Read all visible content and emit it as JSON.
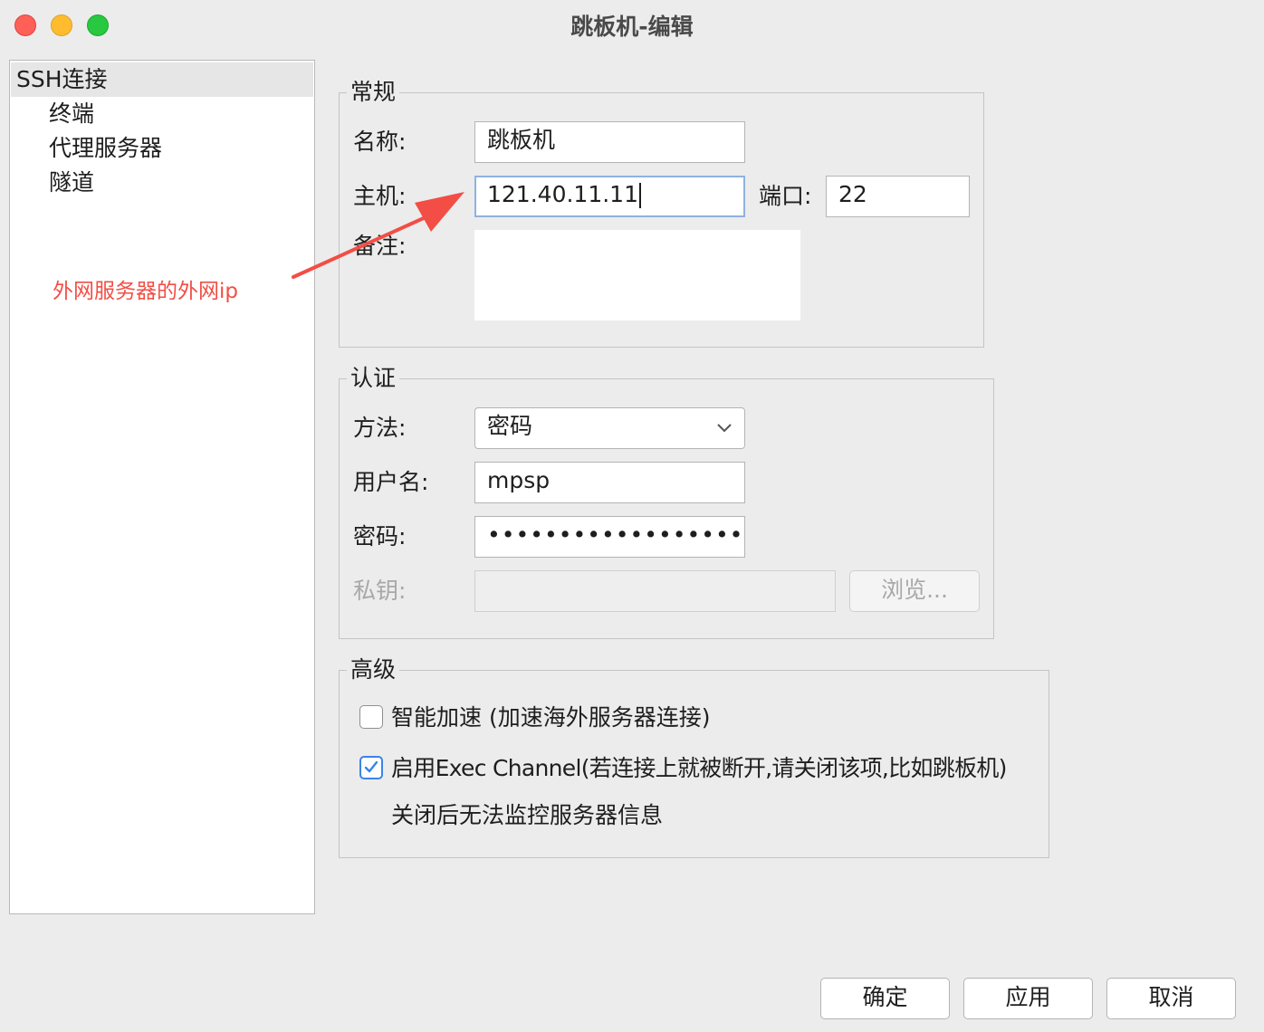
{
  "window": {
    "title": "跳板机-编辑"
  },
  "sidebar": {
    "items": [
      {
        "label": "SSH连接"
      },
      {
        "label": "终端"
      },
      {
        "label": "代理服务器"
      },
      {
        "label": "隧道"
      }
    ]
  },
  "annotation": {
    "text": "外网服务器的外网ip",
    "color": "#f24e45"
  },
  "general": {
    "title": "常规",
    "name_label": "名称:",
    "name_value": "跳板机",
    "host_label": "主机:",
    "host_value": "121.40.11.11",
    "port_label": "端口:",
    "port_value": "22",
    "note_label": "备注:",
    "note_value": ""
  },
  "auth": {
    "title": "认证",
    "method_label": "方法:",
    "method_value": "密码",
    "username_label": "用户名:",
    "username_value": "mpsp",
    "password_label": "密码:",
    "password_mask": "••••••••••••••••••••••••••••",
    "private_key_label": "私钥:",
    "private_key_value": "",
    "browse_label": "浏览..."
  },
  "advanced": {
    "title": "高级",
    "smart_accel_label": "智能加速 (加速海外服务器连接)",
    "smart_accel_checked": false,
    "exec_channel_label": "启用Exec Channel(若连接上就被断开,请关闭该项,比如跳板机)",
    "exec_channel_checked": true,
    "exec_channel_note": "关闭后无法监控服务器信息"
  },
  "footer": {
    "ok_label": "确定",
    "apply_label": "应用",
    "cancel_label": "取消"
  },
  "colors": {
    "accent": "#3b84e6",
    "focus_ring": "#8fb2e0"
  }
}
